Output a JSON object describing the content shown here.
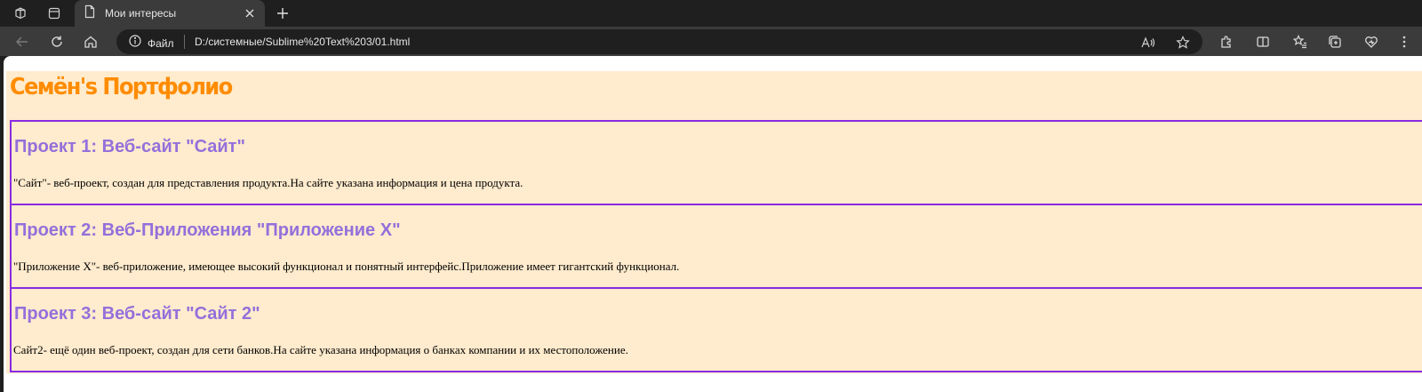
{
  "browser": {
    "tab": {
      "title": "Мои интересы"
    },
    "address": {
      "site_label": "Файл",
      "url": "D:/системные/Sublime%20Text%203/01.html"
    }
  },
  "page": {
    "title": "Семён's Портфолио",
    "projects": [
      {
        "heading": "Проект 1: Веб-сайт \"Сайт\"",
        "description": "\"Сайт\"- веб-проект, создан для представления продукта.На сайте указана информация и цена продукта."
      },
      {
        "heading": "Проект 2: Веб-Приложения \"Приложение Х\"",
        "description": "\"Приложение Х\"- веб-приложение, имеющее высокий функционал и понятный интерфейс.Приложение имеет гигантский функционал."
      },
      {
        "heading": "Проект 3: Веб-сайт \"Сайт 2\"",
        "description": "Сайт2- ещё один веб-проект, создан для сети банков.На сайте указана информация о банках компании и их местоположение."
      }
    ]
  },
  "colors": {
    "page_background": "#ffebcd",
    "title": "#ff8c00",
    "project_border": "#8a2be2",
    "project_heading": "#9370db"
  }
}
